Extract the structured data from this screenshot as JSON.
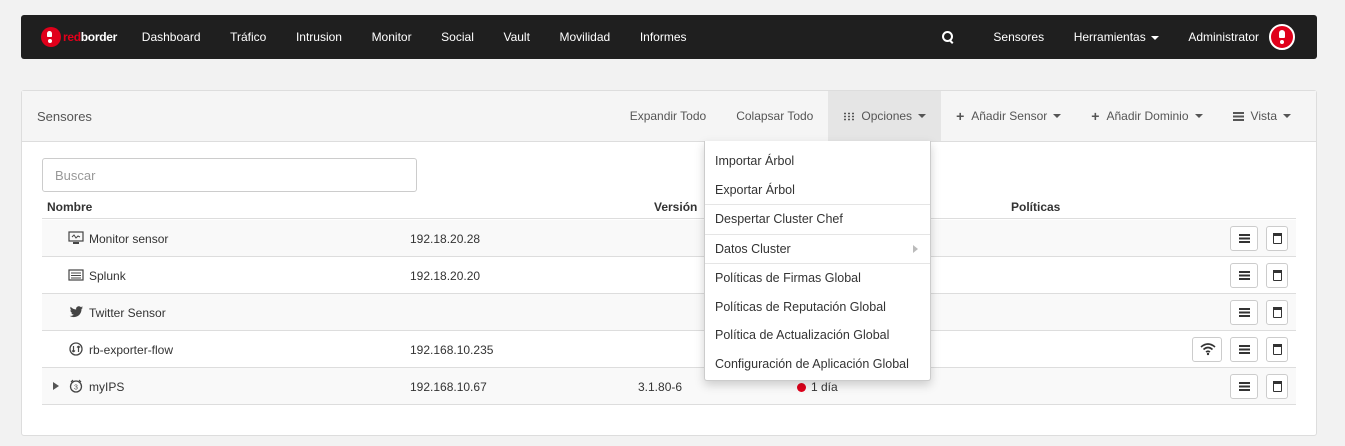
{
  "navbar": {
    "brand_red": "red",
    "brand_white": "border",
    "items": [
      "Dashboard",
      "Tráfico",
      "Intrusion",
      "Monitor",
      "Social",
      "Vault",
      "Movilidad",
      "Informes"
    ],
    "right": {
      "sensores": "Sensores",
      "herramientas": "Herramientas",
      "administrator": "Administrator"
    }
  },
  "panel": {
    "title": "Sensores",
    "toolbar": {
      "expandir": "Expandir Todo",
      "colapsar": "Colapsar Todo",
      "opciones": "Opciones",
      "anadir_sensor": "Añadir Sensor",
      "anadir_dominio": "Añadir Dominio",
      "vista": "Vista"
    },
    "search_placeholder": "Buscar",
    "columns": {
      "nombre": "Nombre",
      "version": "Versión",
      "politicas": "Políticas"
    },
    "rows": [
      {
        "name": "Monitor sensor",
        "ip": "192.18.20.28",
        "version": "",
        "status": "",
        "icon": "monitor-icon"
      },
      {
        "name": "Splunk",
        "ip": "192.18.20.20",
        "version": "",
        "status": "",
        "icon": "splunk-icon"
      },
      {
        "name": "Twitter Sensor",
        "ip": "",
        "version": "",
        "status": "",
        "icon": "twitter-icon"
      },
      {
        "name": "rb-exporter-flow",
        "ip": "192.168.10.235",
        "version": "",
        "status": "",
        "icon": "flow-icon"
      },
      {
        "name": "myIPS",
        "ip": "192.168.10.67",
        "version": "3.1.80-6",
        "status": "1 día",
        "icon": "ips-icon"
      }
    ]
  },
  "dropdown": {
    "items": [
      "Importar Árbol",
      "Exportar Árbol",
      "Despertar Cluster Chef",
      "Datos Cluster",
      "Políticas de Firmas Global",
      "Políticas de Reputación Global",
      "Política de Actualización Global",
      "Configuración de Aplicación Global"
    ]
  },
  "colors": {
    "navbar_bg": "#1f1f1f",
    "brand_red": "#e0001b",
    "status_red": "#e0001b"
  }
}
